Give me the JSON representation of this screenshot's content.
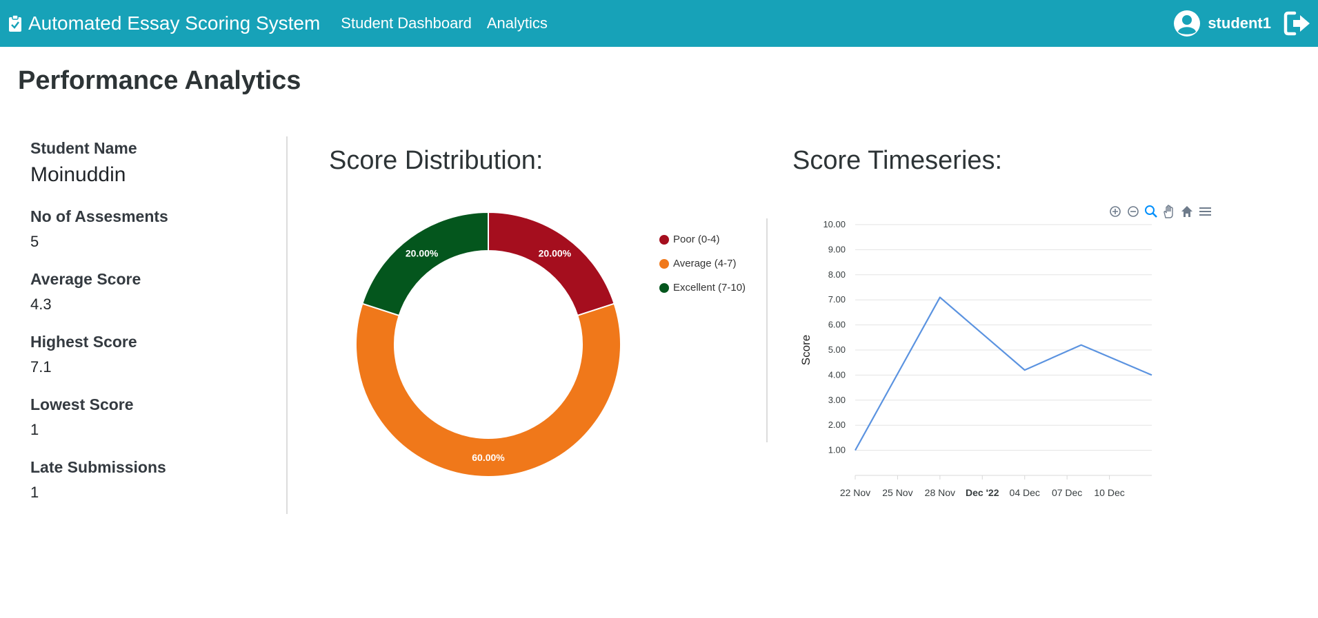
{
  "app": {
    "title": "Automated Essay Scoring System",
    "nav": [
      "Student Dashboard",
      "Analytics"
    ],
    "username": "student1",
    "accent": "#17a2b8"
  },
  "page": {
    "title": "Performance Analytics"
  },
  "stats": {
    "name_label": "Student Name",
    "name_value": "Moinuddin",
    "assessments_label": "No of Assesments",
    "assessments_value": "5",
    "average_label": "Average Score",
    "average_value": "4.3",
    "highest_label": "Highest Score",
    "highest_value": "7.1",
    "lowest_label": "Lowest Score",
    "lowest_value": "1",
    "late_label": "Late Submissions",
    "late_value": "1"
  },
  "distribution": {
    "title": "Score Distribution:"
  },
  "timeseries": {
    "title": "Score Timeseries:",
    "toolbar_icons": [
      "zoom-in-icon",
      "zoom-out-icon",
      "zoom-select-icon",
      "pan-hand-icon",
      "reset-home-icon",
      "menu-icon"
    ]
  },
  "chart_data": [
    {
      "type": "pie",
      "donut": true,
      "labels": [
        "Poor (0-4)",
        "Average (4-7)",
        "Excellent (7-10)"
      ],
      "values": [
        20,
        60,
        20
      ],
      "data_labels": [
        "20.00%",
        "60.00%",
        "20.00%"
      ],
      "colors": [
        "#a50e1e",
        "#f0781a",
        "#04561d"
      ],
      "legend": "right"
    },
    {
      "type": "line",
      "x": [
        "2022-11-22",
        "2022-11-28",
        "2022-12-04",
        "2022-12-08",
        "2022-12-13"
      ],
      "y": [
        1.0,
        7.1,
        4.2,
        5.2,
        4.0
      ],
      "ylabel": "Score",
      "ylim": [
        0,
        10
      ],
      "yticks": [
        "1.00",
        "2.00",
        "3.00",
        "4.00",
        "5.00",
        "6.00",
        "7.00",
        "8.00",
        "9.00",
        "10.00"
      ],
      "xticks": [
        "22 Nov",
        "25 Nov",
        "28 Nov",
        "Dec '22",
        "04 Dec",
        "07 Dec",
        "10 Dec"
      ],
      "grid": true,
      "color": "#5b93e0"
    }
  ]
}
